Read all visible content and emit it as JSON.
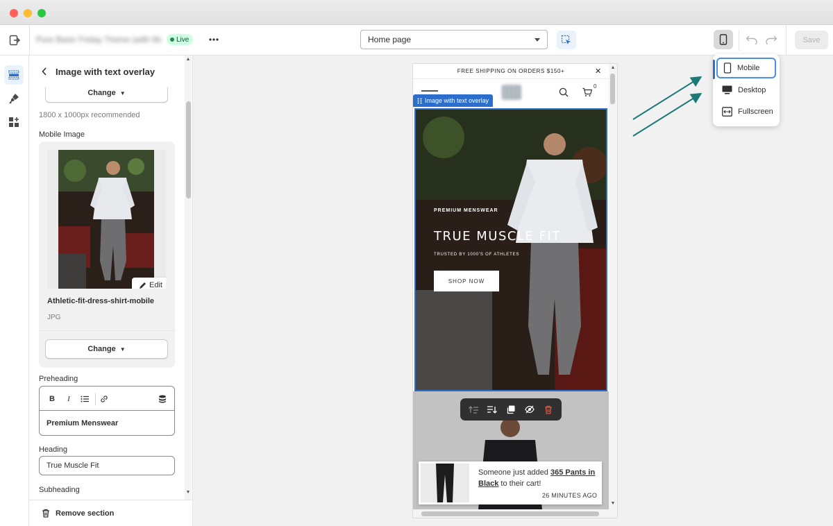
{
  "topbar": {
    "theme_name": "Pure Basic Friday Theme (with MAIN)",
    "live_label": "Live",
    "page_select_value": "Home page",
    "save_label": "Save"
  },
  "panel": {
    "title": "Image with text overlay",
    "change_label_top": "Change",
    "recommended_text": "1800 x 1000px recommended",
    "mobile_image_label": "Mobile Image",
    "edit_label": "Edit",
    "image_filename": "Athletic-fit-dress-shirt-mobile",
    "image_type": "JPG",
    "change_label": "Change",
    "preheading_label": "Preheading",
    "preheading_value": "Premium Menswear",
    "heading_label": "Heading",
    "heading_value": "True Muscle Fit",
    "subheading_label": "Subheading",
    "remove_label": "Remove section"
  },
  "preview": {
    "announcement": "FREE SHIPPING ON ORDERS $150+",
    "cart_count": "0",
    "section_tag": "Image with text overlay",
    "hero_preheading": "PREMIUM MENSWEAR",
    "hero_heading": "TRUE MUSCLE FIT",
    "hero_subheading": "TRUSTED BY 1000'S OF ATHLETES",
    "hero_button": "SHOP NOW",
    "toast_text_pre": "Someone just added ",
    "toast_product": "365 Pants in Black",
    "toast_text_post": " to their cart!",
    "toast_time": "26 MINUTES AGO"
  },
  "device_menu": {
    "items": [
      {
        "label": "Mobile",
        "icon": "mobile-icon"
      },
      {
        "label": "Desktop",
        "icon": "desktop-icon"
      },
      {
        "label": "Fullscreen",
        "icon": "fullscreen-icon"
      }
    ],
    "selected": "Mobile"
  },
  "colors": {
    "accent": "#2c6ecb",
    "annotation_arrow": "#1a7a78",
    "live_badge": "#cdfee1"
  }
}
